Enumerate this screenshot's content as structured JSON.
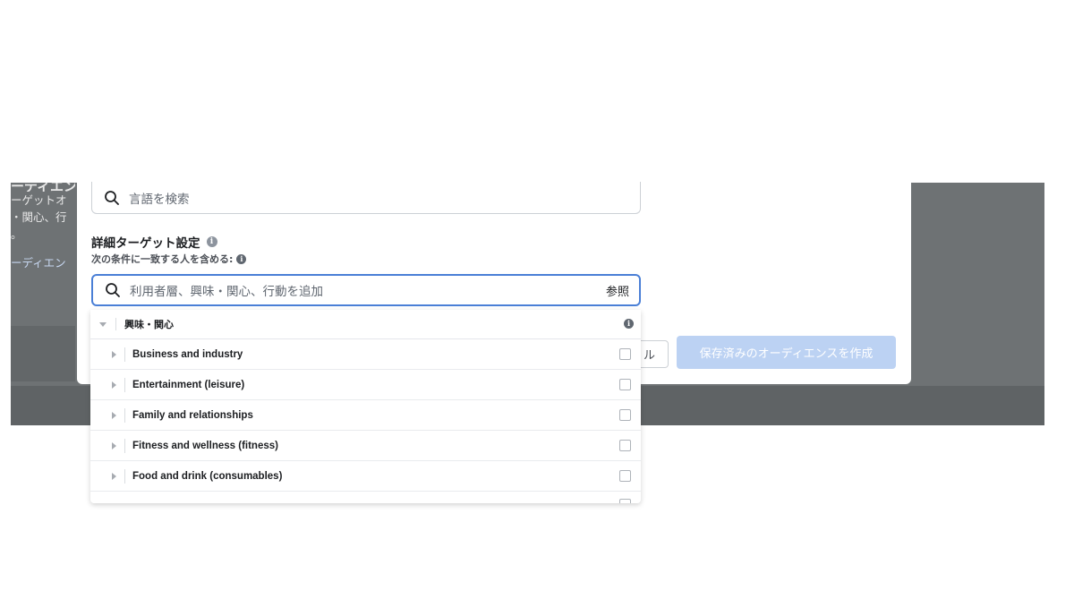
{
  "background": {
    "lines": [
      "ーディエン",
      "ーゲットオ",
      "・関心、行",
      "。"
    ],
    "link_text": "ーディエン"
  },
  "language_search": {
    "placeholder": "言語を検索"
  },
  "detailed_targeting": {
    "title": "詳細ターゲット設定",
    "subtitle": "次の条件に一致する人を含める:",
    "search_placeholder": "利用者層、興味・関心、行動を追加",
    "browse_label": "参照"
  },
  "dropdown": {
    "category": "興味・関心",
    "items": [
      {
        "label": "Business and industry",
        "checked": false
      },
      {
        "label": "Entertainment (leisure)",
        "checked": false
      },
      {
        "label": "Family and relationships",
        "checked": false
      },
      {
        "label": "Fitness and wellness (fitness)",
        "checked": false
      },
      {
        "label": "Food and drink (consumables)",
        "checked": false
      }
    ]
  },
  "footer": {
    "cancel_fragment": "ル",
    "create_button": "保存済みのオーディエンスを作成"
  },
  "colors": {
    "accent": "#4a7fd6",
    "disabled_button": "#bcd2f3",
    "backdrop": "#6e7274"
  },
  "icons": [
    "search-icon",
    "info-icon",
    "caret-down-icon",
    "caret-right-icon"
  ]
}
